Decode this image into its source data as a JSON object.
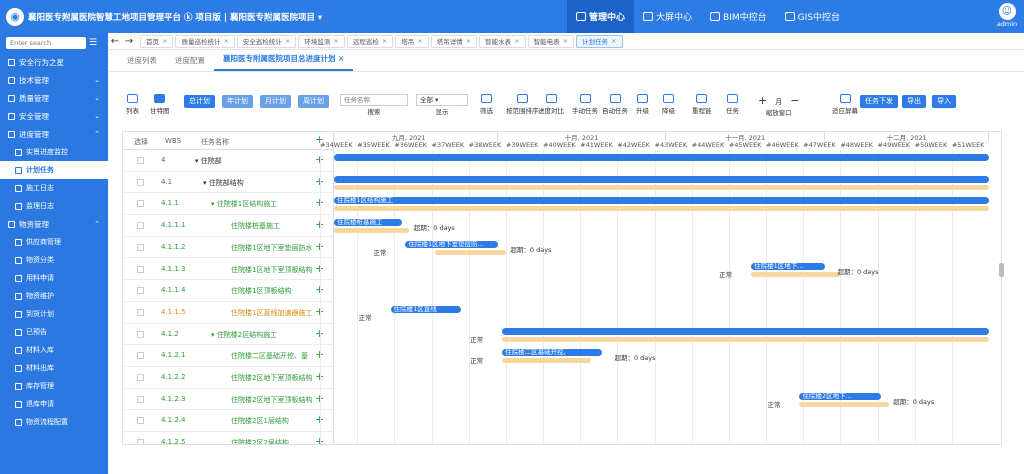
{
  "app": {
    "logo_glyph": "◉",
    "title": "襄阳医专附属医院智慧工地项目管理平台  ⓚ 项目版 | 襄阳医专附属医院项目 ▾"
  },
  "nav": [
    {
      "label": "管理中心",
      "active": true
    },
    {
      "label": "大屏中心"
    },
    {
      "label": "BIM中控台"
    },
    {
      "label": "GIS中控台"
    }
  ],
  "user": {
    "avatar_glyph": "☺",
    "name": "admin"
  },
  "sidebar": {
    "search_placeholder": "Enter search",
    "items": [
      {
        "label": "安全行为之星",
        "type": "top"
      },
      {
        "label": "技术管理",
        "type": "top",
        "caret": "⌄"
      },
      {
        "label": "质量管理",
        "type": "top",
        "caret": "⌄"
      },
      {
        "label": "安全管理",
        "type": "top",
        "caret": "⌄"
      },
      {
        "label": "进度管理",
        "type": "top",
        "caret": "⌃"
      },
      {
        "label": "实景进度监控",
        "type": "sub"
      },
      {
        "label": "计划任务",
        "type": "sub",
        "active": true
      },
      {
        "label": "施工日志",
        "type": "sub"
      },
      {
        "label": "监理日志",
        "type": "sub"
      },
      {
        "label": "物资管理",
        "type": "top",
        "caret": "⌃"
      },
      {
        "label": "供应商管理",
        "type": "sub"
      },
      {
        "label": "物资分类",
        "type": "sub"
      },
      {
        "label": "用料申请",
        "type": "sub"
      },
      {
        "label": "物资维护",
        "type": "sub"
      },
      {
        "label": "到货计划",
        "type": "sub"
      },
      {
        "label": "已预告",
        "type": "sub"
      },
      {
        "label": "材料入库",
        "type": "sub"
      },
      {
        "label": "材料出库",
        "type": "sub"
      },
      {
        "label": "库存管理",
        "type": "sub"
      },
      {
        "label": "退库申请",
        "type": "sub"
      },
      {
        "label": "物资流程配置",
        "type": "sub"
      }
    ]
  },
  "tabbar": {
    "back": "←",
    "forward": "→",
    "tabs": [
      {
        "label": "首页",
        "close": "×"
      },
      {
        "label": "质量巡检统计",
        "close": "×"
      },
      {
        "label": "安全巡检统计",
        "close": "×"
      },
      {
        "label": "环境监测",
        "close": "×"
      },
      {
        "label": "远程巡检",
        "close": "×"
      },
      {
        "label": "塔吊",
        "close": "×"
      },
      {
        "label": "塔吊详情",
        "close": "×"
      },
      {
        "label": "智能水表",
        "close": "×"
      },
      {
        "label": "智能电表",
        "close": "×"
      },
      {
        "label": "计划任务",
        "close": "×",
        "active": true
      }
    ]
  },
  "subtabs": [
    {
      "label": "进度列表"
    },
    {
      "label": "进度配置"
    },
    {
      "label": "襄阳医专附属医院项目总进度计划 ×",
      "active": true
    }
  ],
  "toolbar": {
    "list": "列表",
    "gantt": "甘特图",
    "total_plan": "总计划",
    "year_plan": "年计划",
    "month_plan": "月计划",
    "week_plan": "周计划",
    "task_name_placeholder": "任务名称",
    "search": "搜索",
    "select_all": "全部 ▾",
    "display": "显示",
    "filter": "筛选",
    "sort": "按范围排序",
    "compare": "进度对比",
    "manual_task": "手动任务",
    "auto_task": "自动任务",
    "upgrade": "升级",
    "downgrade": "降级",
    "relink": "重程链",
    "task": "任务",
    "zoom_in": "+",
    "zoom_unit": "月",
    "zoom_out": "−",
    "zoom_label": "缩放窗口",
    "fit_screen": "适应屏幕",
    "dispatch": "任务下发",
    "export": "导出",
    "import": "导入"
  },
  "gantt": {
    "headers": {
      "select": "选择",
      "wbs": "WBS",
      "task_name": "任务名称"
    },
    "plus": "+",
    "rows": [
      {
        "wbs": "4",
        "name": "▾ 住院部",
        "indent": 0,
        "color": "gray"
      },
      {
        "wbs": "4.1",
        "name": "▾ 住院部结构",
        "indent": 1,
        "color": "gray"
      },
      {
        "wbs": "4.1.1",
        "name": "▾ 住院楼1区结构施工",
        "indent": 2,
        "color": "green"
      },
      {
        "wbs": "4.1.1.1",
        "name": "住院楼桩基施工",
        "indent": 3,
        "color": "green"
      },
      {
        "wbs": "4.1.1.2",
        "name": "住院楼1区地下室垫层防水",
        "indent": 3,
        "color": "green"
      },
      {
        "wbs": "4.1.1.3",
        "name": "住院楼1区地下室顶板结构",
        "indent": 3,
        "color": "green"
      },
      {
        "wbs": "4.1.1.4",
        "name": "住院楼1区顶板结构",
        "indent": 3,
        "color": "green"
      },
      {
        "wbs": "4.1.1.5",
        "name": "住院楼1区直线加速器施工",
        "indent": 3,
        "color": "orange"
      },
      {
        "wbs": "4.1.2",
        "name": "▾ 住院楼2区结构施工",
        "indent": 2,
        "color": "green"
      },
      {
        "wbs": "4.1.2.1",
        "name": "住院楼二区基础开挖、基",
        "indent": 3,
        "color": "green"
      },
      {
        "wbs": "4.1.2.2",
        "name": "住院楼2区地下室顶板结构",
        "indent": 3,
        "color": "green"
      },
      {
        "wbs": "4.1.2.3",
        "name": "住院楼2区地下室顶板结构",
        "indent": 3,
        "color": "green"
      },
      {
        "wbs": "4.1.2.4",
        "name": "住院楼2区1层结构",
        "indent": 3,
        "color": "green"
      },
      {
        "wbs": "4.1.2.5",
        "name": "住院楼2区2层结构",
        "indent": 3,
        "color": "green"
      }
    ],
    "months": [
      "九月, 2021",
      "十月, 2021",
      "十一月, 2021",
      "十二月, 2021"
    ],
    "weeks": [
      "#34WEEK",
      "#35WEEK",
      "#36WEEK",
      "#37WEEK",
      "#38WEEK",
      "#39WEEK",
      "#40WEEK",
      "#41WEEK",
      "#42WEEK",
      "#43WEEK",
      "#44WEEK",
      "#45WEEK",
      "#46WEEK",
      "#47WEEK",
      "#48WEEK",
      "#49WEEK",
      "#50WEEK",
      "#51WEEK"
    ],
    "bars": [
      {
        "row": 0,
        "start": 0,
        "end": 18,
        "label": "",
        "baseline": null
      },
      {
        "row": 1,
        "start": 0,
        "end": 18,
        "label": "",
        "baseline": [
          0,
          18
        ]
      },
      {
        "row": 2,
        "start": 0,
        "end": 18,
        "label": "住院楼1区结构施工",
        "baseline": [
          0,
          18
        ]
      },
      {
        "row": 3,
        "start": 0,
        "end": 2.2,
        "label": "住院楼桩基施工",
        "baseline": [
          0,
          2.4
        ],
        "status": "",
        "delay": "超期：0 days"
      },
      {
        "row": 4,
        "start": 2.3,
        "end": 4.8,
        "label": "住院楼1区地下室垫层防...",
        "baseline": [
          3.1,
          5.0
        ],
        "status": "正常",
        "delay": "超期：0 days"
      },
      {
        "row": 5,
        "start": 11.6,
        "end": 13.6,
        "label": "住院楼1区地下...",
        "baseline": [
          11.6,
          14.0
        ],
        "status": "正常",
        "delay": "超期：0 days"
      },
      {
        "row": 7,
        "start": 1.9,
        "end": 3.8,
        "label": "住院楼1区直线",
        "baseline": null,
        "status": "正常",
        "delay": ""
      },
      {
        "row": 8,
        "start": 4.9,
        "end": 18,
        "label": "",
        "baseline": [
          4.9,
          18
        ],
        "status": "正常",
        "delay": ""
      },
      {
        "row": 9,
        "start": 4.9,
        "end": 7.6,
        "label": "住院楼二区基础开挖,",
        "baseline": [
          4.9,
          7.3
        ],
        "status": "正常",
        "delay": "超期：0 days"
      },
      {
        "row": 11,
        "start": 12.9,
        "end": 15.1,
        "label": "住院楼2区地下...",
        "baseline": [
          12.9,
          15.3
        ],
        "status": "正常",
        "delay": "超期：0 days"
      }
    ]
  },
  "colors": {
    "primary": "#2d7be5",
    "baseline": "#f7d79f",
    "green": "#2d9b3a",
    "orange": "#d9890f"
  }
}
